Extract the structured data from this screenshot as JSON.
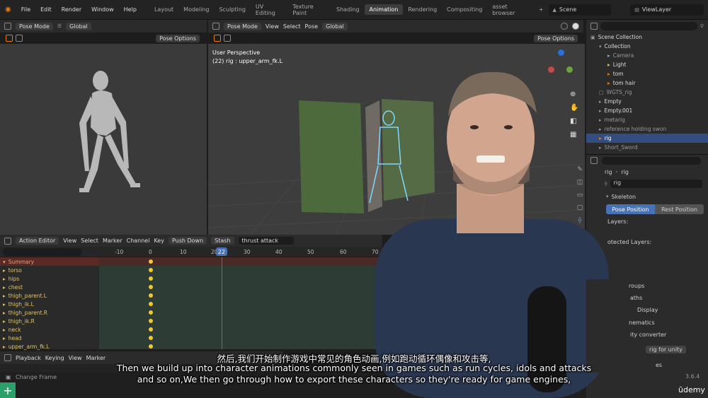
{
  "menus": [
    "File",
    "Edit",
    "Render",
    "Window",
    "Help"
  ],
  "workspaces": [
    "Layout",
    "Modeling",
    "Sculpting",
    "UV Editing",
    "Texture Paint",
    "Shading",
    "Animation",
    "Rendering",
    "Compositing",
    "asset browser",
    "+"
  ],
  "active_workspace": "Animation",
  "scene": "Scene",
  "view_layer": "ViewLayer",
  "left_viewport": {
    "mode": "Pose Mode",
    "orientation": "Global",
    "pose_options": "Pose Options"
  },
  "main_viewport": {
    "mode": "Pose Mode",
    "menus": [
      "View",
      "Select",
      "Pose"
    ],
    "orientation": "Global",
    "pose_options": "Pose Options",
    "perspective": "User Perspective",
    "active": "(22) rig : upper_arm_fk.L"
  },
  "action_editor": {
    "mode": "Action Editor",
    "menus": [
      "View",
      "Select",
      "Marker",
      "Channel",
      "Key"
    ],
    "push_down": "Push Down",
    "stash": "Stash",
    "action": "thrust attack",
    "current_frame": "22",
    "ticks": [
      "-10",
      "0",
      "10",
      "20",
      "30",
      "40",
      "50",
      "60",
      "70"
    ],
    "summary": "Summary",
    "channels": [
      "torso",
      "hips",
      "chest",
      "thigh_parent.L",
      "thigh_ik.L",
      "thigh_parent.R",
      "thigh_ik.R",
      "neck",
      "head",
      "upper_arm_fk.L"
    ]
  },
  "timeline": {
    "menus": [
      "Playback",
      "Keying",
      "View",
      "Marker"
    ],
    "status": "Change Frame"
  },
  "outliner": {
    "title": "Scene Collection",
    "items": [
      "Collection",
      "Camera",
      "Light",
      "tom",
      "tom hair",
      "WGTS_rig",
      "Empty",
      "Empty.001",
      "metarig",
      "reference holding swon",
      "rig",
      "Short_Sword"
    ]
  },
  "properties": {
    "object": "rig",
    "data": "rig",
    "data_field": "rig",
    "skeleton": "Skeleton",
    "pose_position": "Pose Position",
    "rest_position": "Rest Position",
    "layers": "Layers:",
    "protected_layers": "otected Layers:",
    "groups": "roups",
    "paths": "aths",
    "display": "Display",
    "inematics": "nematics",
    "converter": "ity converter",
    "rig_for_unity": "rig for unity",
    "es": "es"
  },
  "version": "3.6.4",
  "brand": "ūdemy",
  "subtitles": {
    "zh": "然后,我们开始制作游戏中常见的角色动画,例如跑动循环偶像和攻击等,",
    "en1": "Then we build up into character animations commonly seen in games such as run cycles, idols and attacks",
    "en2": "and so on,We then go through how to export these characters so they're ready for game engines,"
  }
}
